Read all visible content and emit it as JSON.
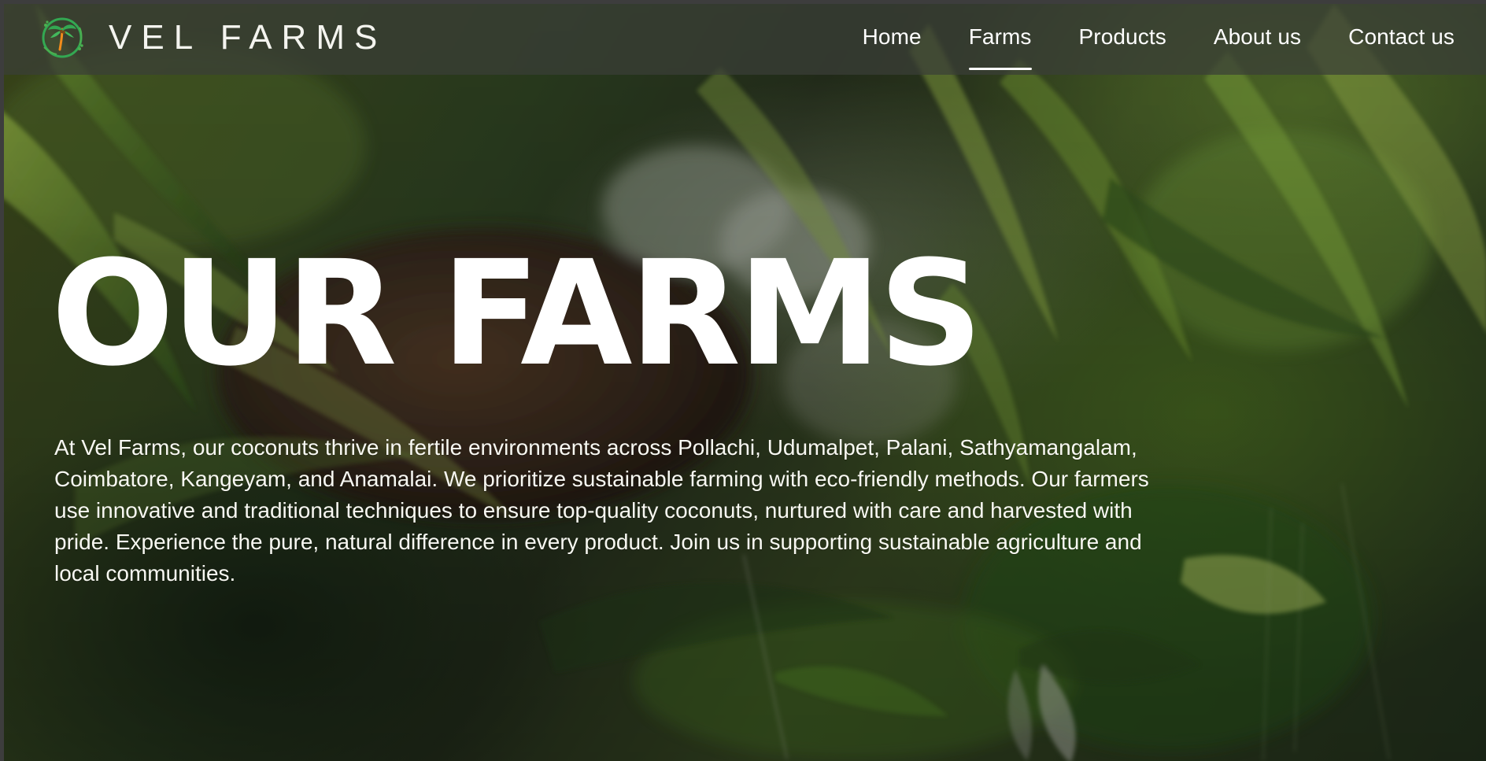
{
  "brand": {
    "name": "VEL FARMS",
    "logo_icon": "palm-tree-logo-icon",
    "accent": "#33a852"
  },
  "nav": {
    "items": [
      {
        "label": "Home",
        "active": false
      },
      {
        "label": "Farms",
        "active": true
      },
      {
        "label": "Products",
        "active": false
      },
      {
        "label": "About us",
        "active": false
      },
      {
        "label": "Contact us",
        "active": false
      }
    ]
  },
  "hero": {
    "title": "OUR FARMS",
    "description": "At Vel Farms, our coconuts thrive in fertile environments across Pollachi, Udumalpet, Palani, Sathyamangalam, Coimbatore, Kangeyam, and Anamalai. We prioritize sustainable farming with eco-friendly methods. Our farmers use innovative and traditional techniques to ensure top-quality coconuts, nurtured with care and harvested with pride. Experience the pure, natural difference in every product. Join us in supporting sustainable agriculture and local communities."
  },
  "colors": {
    "header_background": "#3a3e37",
    "text": "#ffffff"
  }
}
